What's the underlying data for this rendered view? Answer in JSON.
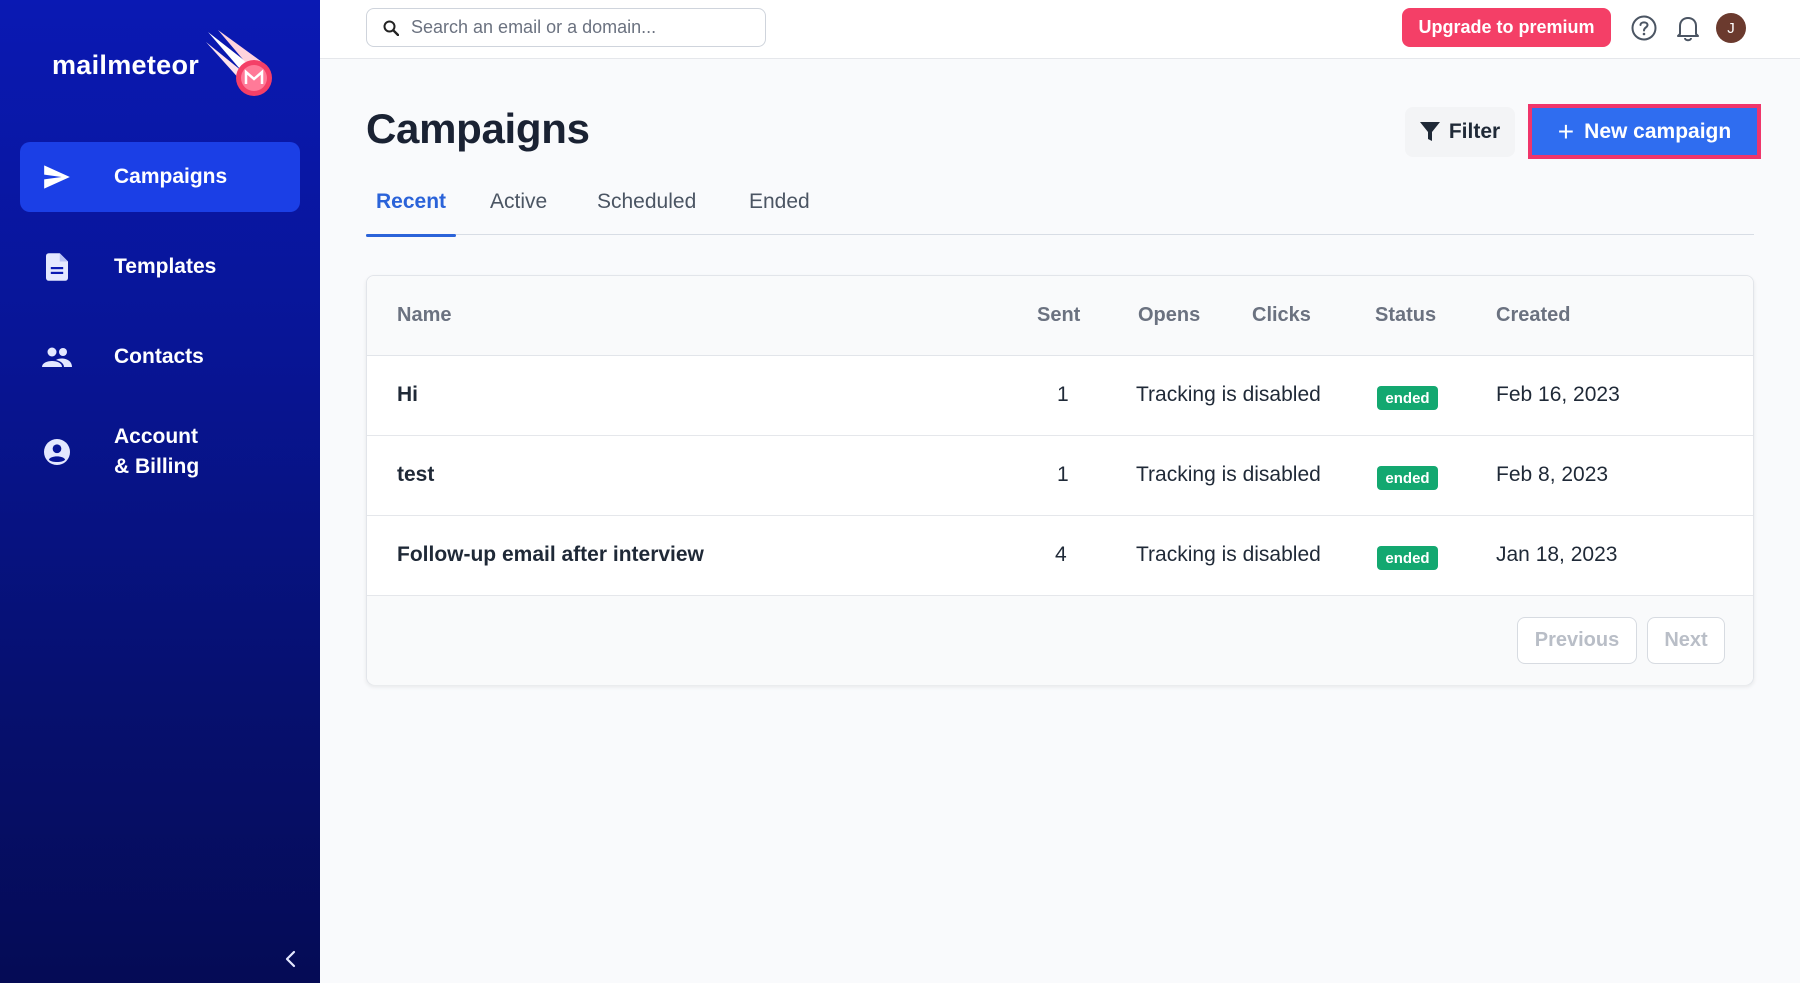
{
  "sidebar": {
    "brand": "mailmeteor",
    "items": [
      {
        "label": "Campaigns",
        "icon": "send-icon",
        "active": true
      },
      {
        "label": "Templates",
        "icon": "document-icon",
        "active": false
      },
      {
        "label": "Contacts",
        "icon": "people-icon",
        "active": false
      },
      {
        "label_line1": "Account",
        "label_line2": "& Billing",
        "icon": "account-circle-icon",
        "active": false
      }
    ],
    "collapse_icon": "chevron-left-icon"
  },
  "topbar": {
    "search_placeholder": "Search an email or a domain...",
    "upgrade_label": "Upgrade to premium",
    "avatar_initial": "J"
  },
  "main": {
    "title": "Campaigns",
    "filter_label": "Filter",
    "new_campaign_label": "New campaign",
    "tabs": [
      "Recent",
      "Active",
      "Scheduled",
      "Ended"
    ],
    "active_tab": "Recent"
  },
  "table": {
    "columns": [
      "Name",
      "Sent",
      "Opens",
      "Clicks",
      "Status",
      "Created"
    ],
    "rows": [
      {
        "name": "Hi",
        "sent": "1",
        "tracking": "Tracking is disabled",
        "status": "ended",
        "created": "Feb 16, 2023"
      },
      {
        "name": "test",
        "sent": "1",
        "tracking": "Tracking is disabled",
        "status": "ended",
        "created": "Feb 8, 2023"
      },
      {
        "name": "Follow-up email after interview",
        "sent": "4",
        "tracking": "Tracking is disabled",
        "status": "ended",
        "created": "Jan 18, 2023"
      }
    ],
    "pagination": {
      "previous": "Previous",
      "next": "Next"
    }
  },
  "colors": {
    "sidebar": "#0a19b3",
    "accent": "#2f6df0",
    "upgrade": "#f43f67",
    "badge": "#13a870",
    "highlight": "#f0356b"
  }
}
